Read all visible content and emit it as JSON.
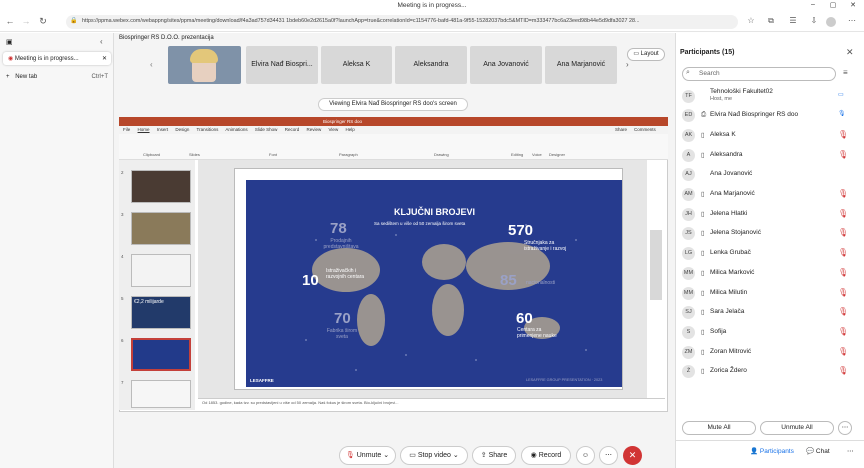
{
  "browser": {
    "window_title": "Meeting is in progress...",
    "url": "https://ppma.webex.com/webappng/sites/ppma/meeting/download/f4a3ad757d34431 1bdeb60e2d2615a0f?launchApp=true&correlationId=c1154776-bafd-481a-9f55-15282037bdc5&MTID=m333477bc6a23eed98b44e5d9dfa3027 28..."
  },
  "left_panel": {
    "tab_label": "Meeting is in progress...",
    "new_tab_label": "New tab",
    "new_tab_shortcut": "Ctrl+T"
  },
  "meeting": {
    "title": "Biospringer RS D.O.O. prezentacija",
    "layout_label": "Layout",
    "viewing_label": "Viewing Elvira Nađ Biospringer RS doo's screen",
    "video_tiles": [
      "Elvira Nađ Biospri...",
      "Aleksa K",
      "Aleksandra",
      "Ana Jovanović",
      "Ana Marjanović"
    ]
  },
  "ppt": {
    "title": "Biospringer RS doo",
    "tabs": [
      "File",
      "Home",
      "Insert",
      "Design",
      "Transitions",
      "Animations",
      "Slide Show",
      "Record",
      "Review",
      "View",
      "Help"
    ],
    "share_label": "Share",
    "comments_label": "Comments",
    "ribbon_groups": [
      "Clipboard",
      "Slides",
      "Font",
      "Paragraph",
      "Drawing",
      "Editing",
      "Voice",
      "Designer"
    ],
    "thumb_numbers": [
      "2",
      "3",
      "4",
      "5",
      "6",
      "7"
    ],
    "thumb_caption": "€2,2 milijarde",
    "notes": "Od 1853. godine, kada tzv. su predstavljeni u više od 50 zemalja. Naš fokus je širom sveta. Bio-ključni brojevi..."
  },
  "slide": {
    "title": "KLJUČNI BROJEVI",
    "subtitle": "Sa sedištem u više od 50 zemalja širom sveta",
    "stats": [
      {
        "value": "78",
        "label": "Prodajnih predstavništava",
        "dim": true
      },
      {
        "value": "570",
        "label": "Stručnjaka za istraživanje i razvoj",
        "dim": false
      },
      {
        "value": "10",
        "label": "Istraživačkih i razvojnih centara",
        "dim": false
      },
      {
        "value": "85",
        "label": "nacionalnosti",
        "dim": true
      },
      {
        "value": "70",
        "label": "Fabrika širom sveta",
        "dim": true
      },
      {
        "value": "60",
        "label": "Centara za primenjene nauke",
        "dim": false
      }
    ],
    "brand": "LESAFFRE",
    "footer": "LESAFFRE GROUP PRESENTATION · 2023"
  },
  "controls": {
    "unmute": "Unmute",
    "stop_video": "Stop video",
    "share": "Share",
    "record": "Record"
  },
  "participants": {
    "title": "Participants (15)",
    "search_placeholder": "Search",
    "list": [
      {
        "initials": "TF",
        "name": "Tehnološki Fakultet02",
        "sub": "Host, me",
        "muted": false
      },
      {
        "initials": "ED",
        "name": "Elvira Nađ Biospringer RS doo",
        "sub": "",
        "muted": false
      },
      {
        "initials": "AK",
        "name": "Aleksa K",
        "sub": "",
        "muted": true
      },
      {
        "initials": "A",
        "name": "Aleksandra",
        "sub": "",
        "muted": true
      },
      {
        "initials": "AJ",
        "name": "Ana Jovanović",
        "sub": "",
        "muted": false
      },
      {
        "initials": "AM",
        "name": "Ana Marjanović",
        "sub": "",
        "muted": true
      },
      {
        "initials": "JH",
        "name": "Jelena Hlatki",
        "sub": "",
        "muted": true
      },
      {
        "initials": "JS",
        "name": "Jelena Stojanović",
        "sub": "",
        "muted": true
      },
      {
        "initials": "LG",
        "name": "Lenka Grubač",
        "sub": "",
        "muted": true
      },
      {
        "initials": "MM",
        "name": "Milica Marković",
        "sub": "",
        "muted": true
      },
      {
        "initials": "MM",
        "name": "Milica Milutin",
        "sub": "",
        "muted": true
      },
      {
        "initials": "SJ",
        "name": "Sara Jelača",
        "sub": "",
        "muted": true
      },
      {
        "initials": "S",
        "name": "Sofija",
        "sub": "",
        "muted": true
      },
      {
        "initials": "ZM",
        "name": "Zoran Mitrović",
        "sub": "",
        "muted": true
      },
      {
        "initials": "Ž",
        "name": "Zorica Ždero",
        "sub": "",
        "muted": true
      }
    ],
    "mute_all": "Mute All",
    "unmute_all": "Unmute All",
    "tab_participants": "Participants",
    "tab_chat": "Chat"
  }
}
